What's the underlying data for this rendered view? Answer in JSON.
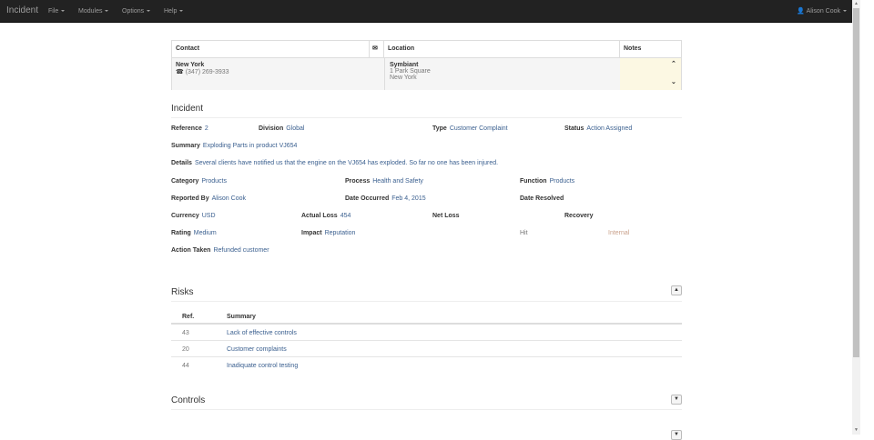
{
  "nav": {
    "brand": "Incident",
    "menus": [
      "File",
      "Modules",
      "Options",
      "Help"
    ],
    "user": "Alison Cook"
  },
  "contact_card": {
    "headers": {
      "contact": "Contact",
      "location": "Location",
      "notes": "Notes"
    },
    "contact": {
      "name": "New York",
      "phone": "(347) 269-3933"
    },
    "location": {
      "name": "Symbiant",
      "line1": "1 Park Square",
      "line2": "New York"
    }
  },
  "incident": {
    "title": "Incident",
    "fields": {
      "reference": {
        "label": "Reference",
        "value": "2"
      },
      "division": {
        "label": "Division",
        "value": "Global"
      },
      "type": {
        "label": "Type",
        "value": "Customer Complaint"
      },
      "status": {
        "label": "Status",
        "value": "Action Assigned"
      },
      "summary": {
        "label": "Summary",
        "value": "Exploding Parts in product VJ654"
      },
      "details": {
        "label": "Details",
        "value": "Several clients have notified us that the engine on the VJ654 has exploded. So far no one has been injured."
      },
      "category": {
        "label": "Category",
        "value": "Products"
      },
      "process": {
        "label": "Process",
        "value": "Health and Safety"
      },
      "function": {
        "label": "Function",
        "value": "Products"
      },
      "reported_by": {
        "label": "Reported By",
        "value": "Alison Cook"
      },
      "date_occurred": {
        "label": "Date Occurred",
        "value": "Feb 4, 2015"
      },
      "date_resolved": {
        "label": "Date Resolved",
        "value": ""
      },
      "currency": {
        "label": "Currency",
        "value": "USD"
      },
      "actual_loss": {
        "label": "Actual Loss",
        "value": "454"
      },
      "net_loss": {
        "label": "Net Loss",
        "value": ""
      },
      "recovery": {
        "label": "Recovery",
        "value": ""
      },
      "rating": {
        "label": "Rating",
        "value": "Medium"
      },
      "impact": {
        "label": "Impact",
        "value": "Reputation"
      },
      "hit": "Hit",
      "internal": "Internal",
      "action_taken": {
        "label": "Action Taken",
        "value": "Refunded customer"
      }
    }
  },
  "risks": {
    "title": "Risks",
    "headers": [
      "Ref.",
      "Summary"
    ],
    "rows": [
      {
        "ref": "43",
        "summary": "Lack of effective controls"
      },
      {
        "ref": "20",
        "summary": "Customer complaints"
      },
      {
        "ref": "44",
        "summary": "Inadiquate control testing"
      }
    ]
  },
  "controls": {
    "title": "Controls"
  }
}
